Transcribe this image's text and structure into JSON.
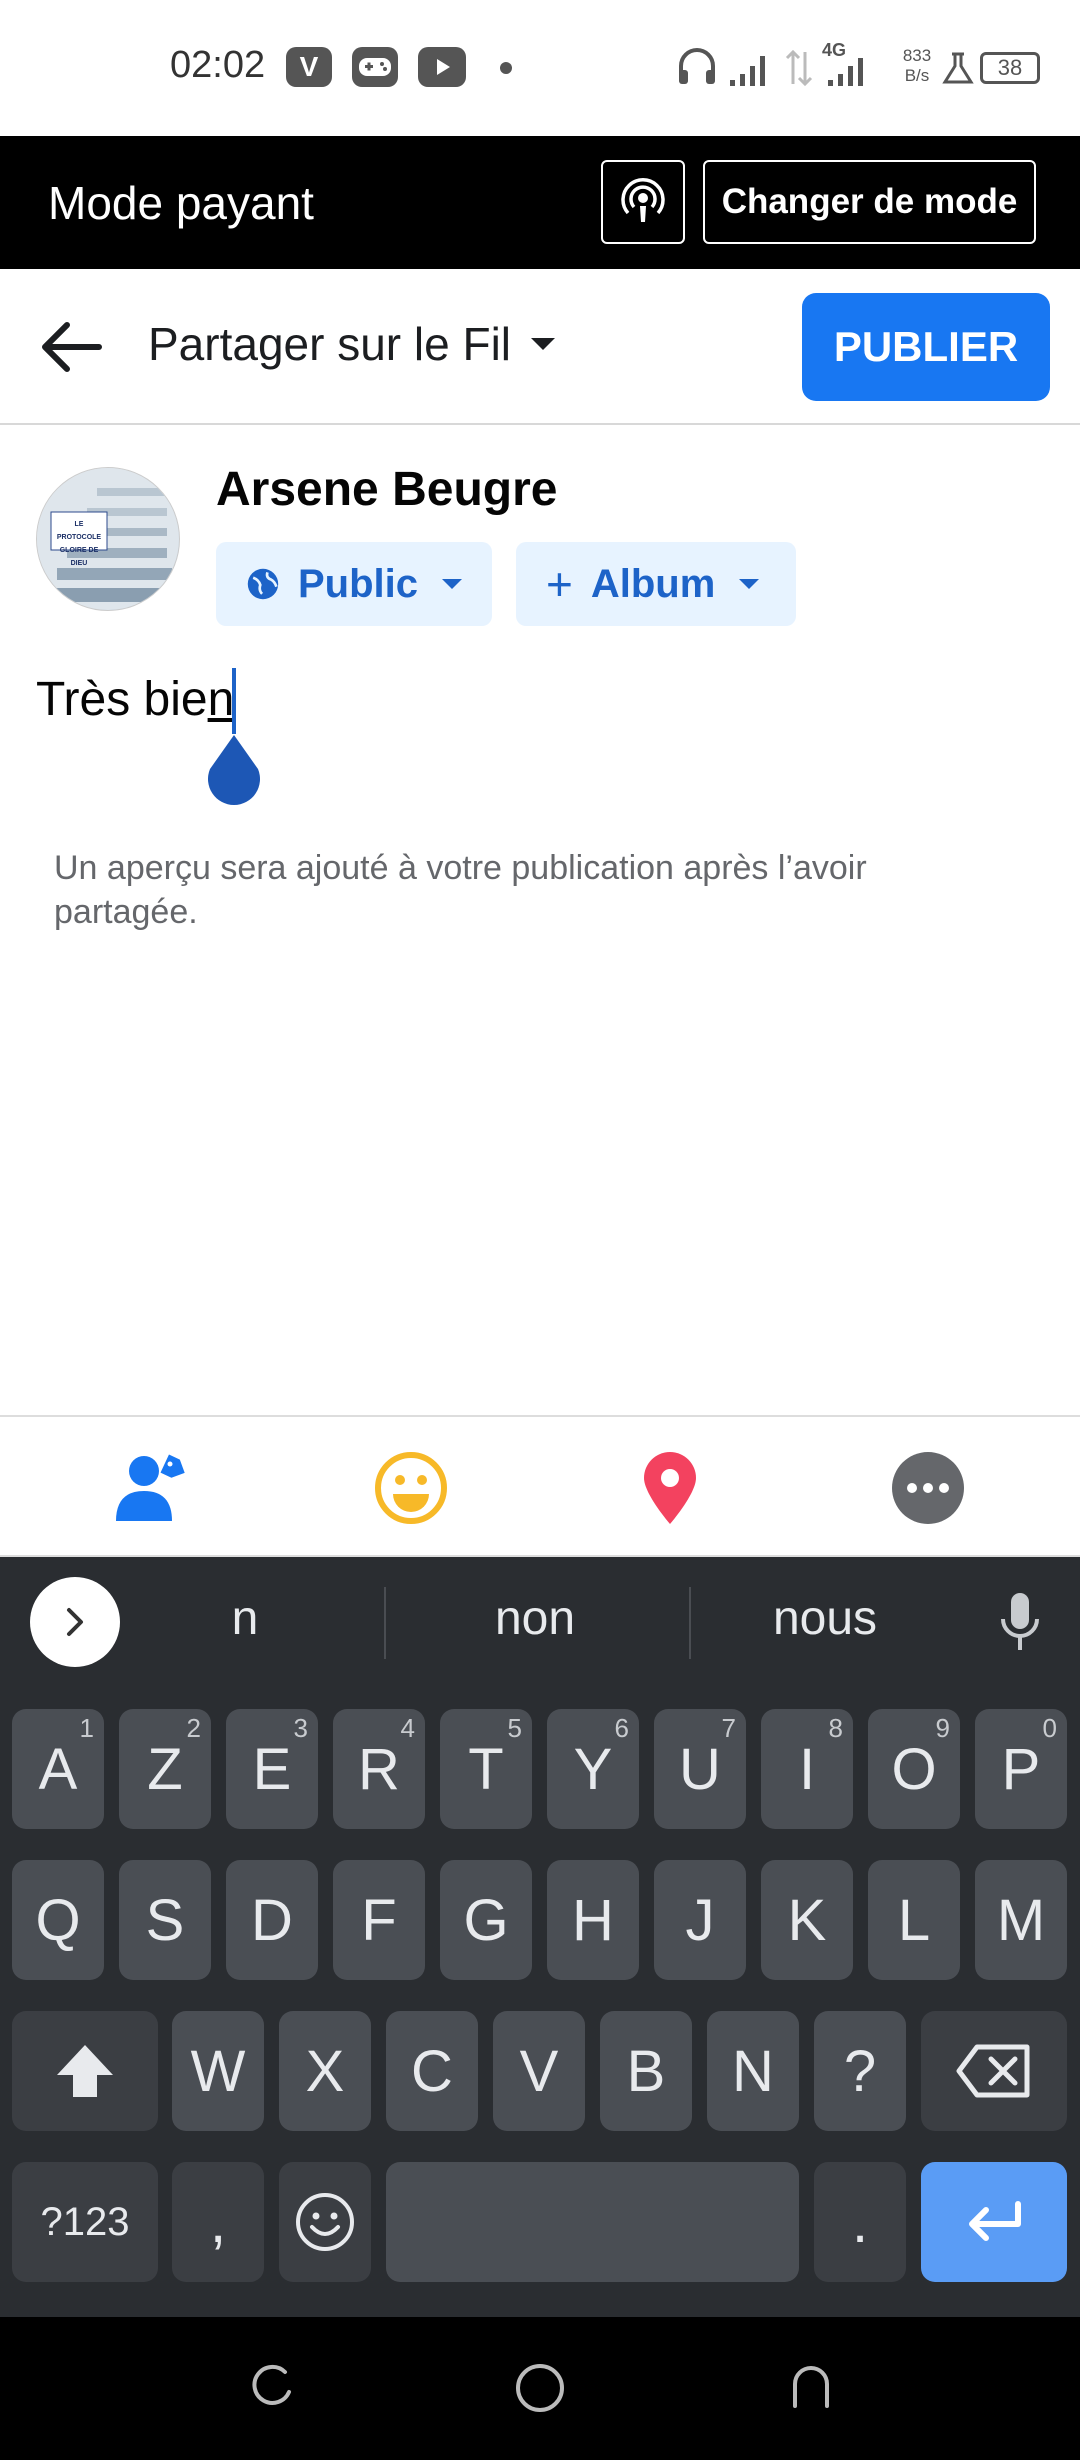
{
  "status_bar": {
    "time": "02:02",
    "app_icons": [
      "V",
      "gamepad-icon",
      "youtube-icon"
    ],
    "net_speed_value": "833",
    "net_speed_unit": "B/s",
    "network_type": "4G",
    "battery": "38"
  },
  "mode_bar": {
    "title": "Mode payant",
    "change_mode_label": "Changer de mode"
  },
  "header": {
    "share_target": "Partager sur le Fil",
    "publish_label": "PUBLIER"
  },
  "composer": {
    "user_name": "Arsene Beugre",
    "audience_label": "Public",
    "album_label": "Album",
    "post_text_plain": "Très bie",
    "post_text_underlined": "n",
    "preview_note": "Un aperçu sera ajouté à votre publication après l’avoir partagée.",
    "avatar_text_line1": "LE PROTOCOLE",
    "avatar_text_line2": "GLOIRE DE DIEU"
  },
  "toolbar": {
    "icons": [
      "tag-people-icon",
      "emoji-icon",
      "location-icon",
      "more-icon"
    ]
  },
  "keyboard": {
    "suggestions": [
      "n",
      "non",
      "nous"
    ],
    "row1": [
      {
        "key": "A",
        "hint": "1"
      },
      {
        "key": "Z",
        "hint": "2"
      },
      {
        "key": "E",
        "hint": "3"
      },
      {
        "key": "R",
        "hint": "4"
      },
      {
        "key": "T",
        "hint": "5"
      },
      {
        "key": "Y",
        "hint": "6"
      },
      {
        "key": "U",
        "hint": "7"
      },
      {
        "key": "I",
        "hint": "8"
      },
      {
        "key": "O",
        "hint": "9"
      },
      {
        "key": "P",
        "hint": "0"
      }
    ],
    "row2": [
      "Q",
      "S",
      "D",
      "F",
      "G",
      "H",
      "J",
      "K",
      "L",
      "M"
    ],
    "row3": [
      "W",
      "X",
      "C",
      "V",
      "B",
      "N",
      "?"
    ],
    "symbols_label": "?123",
    "comma_label": ",",
    "period_label": "."
  },
  "colors": {
    "brand_blue": "#1877f2",
    "chip_bg": "#e7f3ff",
    "chip_text": "#1d63c8",
    "tag_icon": "#1877f2",
    "emoji_icon": "#f7b928",
    "location_icon": "#f3425f",
    "more_icon": "#65676b",
    "keyboard_bg": "#2a2d31",
    "key_bg": "#4a4e54",
    "enter_key": "#5a9cf5"
  }
}
